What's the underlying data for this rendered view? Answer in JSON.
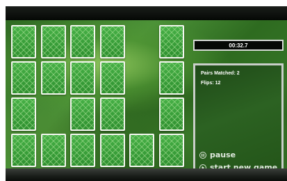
{
  "timer": {
    "value": "00:32.7"
  },
  "stats": {
    "pairs_matched": "Pairs Matched: 2",
    "flips": "Flips: 12"
  },
  "actions": {
    "pause_label": "pause",
    "new_game_label": "start new game"
  },
  "board": {
    "columns": 6,
    "rows": 4,
    "face_down_cards": [
      [
        true,
        true,
        true,
        true,
        false,
        true
      ],
      [
        true,
        true,
        true,
        true,
        false,
        true
      ],
      [
        true,
        false,
        true,
        true,
        false,
        true
      ],
      [
        true,
        true,
        true,
        true,
        true,
        true
      ]
    ]
  },
  "colors": {
    "felt": "#3c7e2c",
    "card_back": "#3aa23a",
    "card_border": "#f4f7f0",
    "panel_border": "#c9cec9"
  },
  "icons": {
    "pause": "pause-circle-icon",
    "new_game": "play-circle-icon"
  }
}
